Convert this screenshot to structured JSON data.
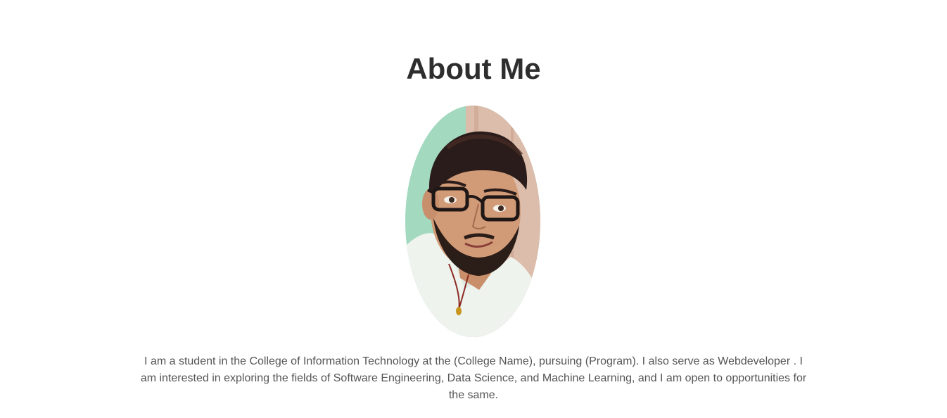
{
  "about": {
    "title": "About Me",
    "bio": "I am a student in the College of Information Technology at the (College Name), pursuing (Program). I also serve as Webdeveloper . I am interested in exploring the fields of Software Engineering, Data Science, and Machine Learning, and I am open to opportunities for the same."
  },
  "colors": {
    "heading": "#2e2e2e",
    "body_text": "#555555",
    "background": "#ffffff",
    "photo_wall_green": "#9fd6bc",
    "photo_door_wood": "#d8b9a6"
  }
}
